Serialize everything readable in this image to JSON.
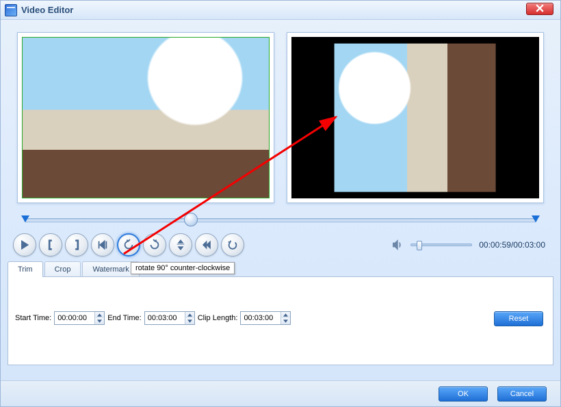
{
  "window": {
    "title": "Video Editor"
  },
  "timeline": {
    "position_percent": 33
  },
  "playback": {
    "current": "00:00:59",
    "total": "00:03:00"
  },
  "tooltip": "rotate 90° counter-clockwise",
  "tabs": [
    {
      "id": "trim",
      "label": "Trim",
      "active": true
    },
    {
      "id": "crop",
      "label": "Crop",
      "active": false
    },
    {
      "id": "watermark",
      "label": "Watermark",
      "active": false
    }
  ],
  "trim": {
    "start_label": "Start Time:",
    "start_value": "00:00:00",
    "end_label": "End Time:",
    "end_value": "00:03:00",
    "clip_label": "Clip Length:",
    "clip_value": "00:03:00"
  },
  "buttons": {
    "reset": "Reset",
    "ok": "OK",
    "cancel": "Cancel"
  },
  "icons": {
    "play": "play",
    "bracket_open": "set-start",
    "bracket_close": "set-end",
    "next_bracket": "goto-end-bracket",
    "rotate_ccw": "rotate-ccw",
    "rotate_cw": "rotate-cw",
    "flip_v": "flip-vertical",
    "prev_frame": "step",
    "undo": "undo",
    "speaker": "speaker"
  }
}
